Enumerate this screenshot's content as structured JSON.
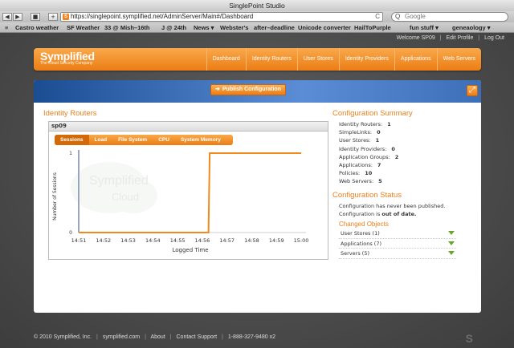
{
  "window": {
    "title": "SinglePoint Studio"
  },
  "browser": {
    "url": "https://singlepoint.symplified.net/AdminServer/Main#/Dashboard",
    "favicon_letter": "S",
    "search_placeholder": "Google",
    "back_glyph": "◀",
    "forward_glyph": "▶",
    "stop_glyph": "■",
    "add_glyph": "+",
    "reload_glyph": "C",
    "search_glyph": "Q",
    "bookmarks_icon": "≡",
    "bookmarks": [
      "Castro weather",
      "SF Weather",
      "33 @ Mish–16th",
      "J @ 24th",
      "News ▾",
      "Webster's",
      "after–deadline",
      "Unicode converter",
      "HailToPurple",
      "fun stuff ▾",
      "geneaology ▾"
    ]
  },
  "userbar": {
    "welcome": "Welcome SP09",
    "edit_profile": "Edit Profile",
    "logout": "Log Out",
    "sep": "|"
  },
  "header": {
    "logo_name": "Symplified",
    "logo_tagline": "The Cloud Security Company",
    "nav": [
      "Dashboard",
      "Identity Routers",
      "User Stores",
      "Identity Providers",
      "Applications",
      "Web Servers"
    ]
  },
  "toolbar": {
    "publish_label": "Publish Configuration",
    "publish_arrow": "➔",
    "expand_glyph": "⤢"
  },
  "identity_routers": {
    "title": "Identity Routers",
    "router_name": "sp09",
    "tabs": [
      "Sessions",
      "Load",
      "File System",
      "CPU",
      "System Memory"
    ],
    "watermark_line1": "Symplified",
    "watermark_line2": "Cloud"
  },
  "chart_data": {
    "type": "line",
    "xlabel": "Logged Time",
    "ylabel": "Number of Sessions",
    "x": [
      "14:51",
      "14:52",
      "14:53",
      "14:54",
      "14:55",
      "14:56",
      "14:57",
      "14:58",
      "14:59",
      "15:00"
    ],
    "ylim": [
      0,
      1
    ],
    "yticks": [
      0,
      1
    ],
    "series": [
      {
        "points": [
          [
            0,
            0
          ],
          [
            5.25,
            0
          ],
          [
            5.3,
            1
          ],
          [
            9,
            1
          ]
        ]
      }
    ],
    "color": "#f08a1c",
    "grid": false
  },
  "config_summary": {
    "title": "Configuration Summary",
    "items": [
      {
        "label": "Identity Routers:",
        "value": "1"
      },
      {
        "label": "SimpleLinks:",
        "value": "0"
      },
      {
        "label": "User Stores:",
        "value": "1"
      },
      {
        "label": "Identity Providers:",
        "value": "0"
      },
      {
        "label": "Application Groups:",
        "value": "2"
      },
      {
        "label": "Applications:",
        "value": "7"
      },
      {
        "label": "Policies:",
        "value": "10"
      },
      {
        "label": "Web Servers:",
        "value": "5"
      }
    ]
  },
  "config_status": {
    "title": "Configuration Status",
    "line1": "Configuration has never been published.",
    "line2_prefix": "Configuration is ",
    "line2_value": "out of date.",
    "changed_title": "Changed Objects",
    "changed": [
      {
        "label": "User Stores",
        "count": "(1)"
      },
      {
        "label": "Applications",
        "count": "(7)"
      },
      {
        "label": "Servers",
        "count": "(5)"
      }
    ]
  },
  "footer": {
    "copyright": "© 2010 Symplified, Inc.",
    "site": "symplified.com",
    "about": "About",
    "contact": "Contact Support",
    "phone": "1-888-327-9480 x2",
    "sep": "|",
    "mark": "S"
  },
  "colors": {
    "accent": "#ec7d15",
    "chart_line": "#f08a1c",
    "banner_blue": "#1b4d93",
    "title_orange": "#e8801c"
  }
}
